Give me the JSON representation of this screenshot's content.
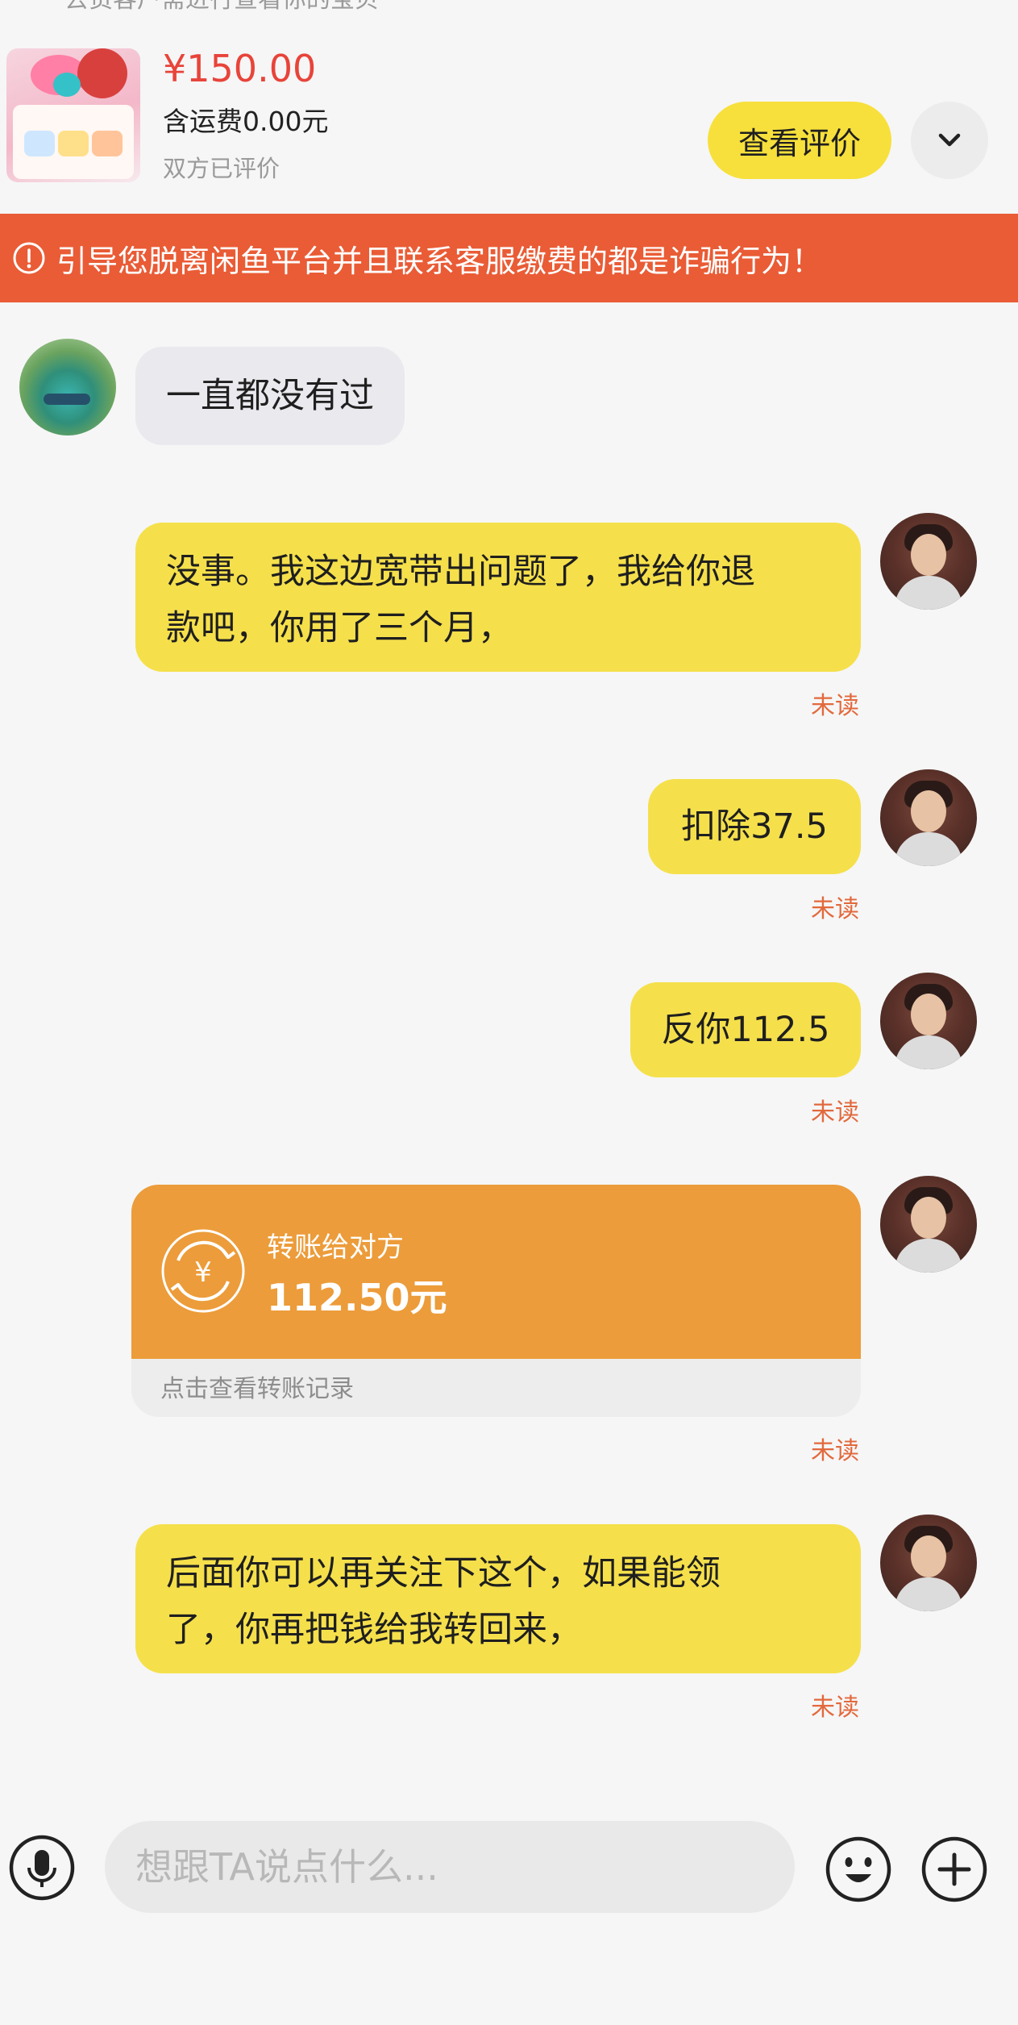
{
  "header": {
    "cut_text": "去货客户需进行查看你的宝贝",
    "price": "¥150.00",
    "shipping": "含运费0.00元",
    "review_status": "双方已评价",
    "review_button": "查看评价"
  },
  "banner": {
    "text": "引导您脱离闲鱼平台并且联系客服缴费的都是诈骗行为！"
  },
  "messages": [
    {
      "side": "left",
      "text": "一直都没有过"
    },
    {
      "side": "right",
      "line1": "没事。我这边宽带出问题了，我给你退",
      "line2": "款吧，你用了三个月，",
      "status": "未读"
    },
    {
      "side": "right",
      "text": "扣除37.5",
      "status": "未读"
    },
    {
      "side": "right",
      "text": "反你112.5",
      "status": "未读"
    },
    {
      "side": "right",
      "type": "transfer",
      "label": "转账给对方",
      "amount": "112.50元",
      "footer": "点击查看转账记录",
      "status": "未读"
    },
    {
      "side": "right",
      "line1": "后面你可以再关注下这个，如果能领",
      "line2": "了，你再把钱给我转回来，",
      "status": "未读"
    }
  ],
  "input": {
    "placeholder": "想跟TA说点什么..."
  },
  "icons": {
    "voice": "microphone-icon",
    "emoji": "emoji-icon",
    "plus": "plus-icon",
    "expand": "chevron-down-icon",
    "warning": "warning-icon",
    "transfer": "yen-transfer-icon"
  },
  "colors": {
    "accent_yellow": "#f7e03c",
    "banner": "#e95c36",
    "price": "#e8443a",
    "unread": "#e2693d",
    "transfer": "#ec9c3a"
  }
}
